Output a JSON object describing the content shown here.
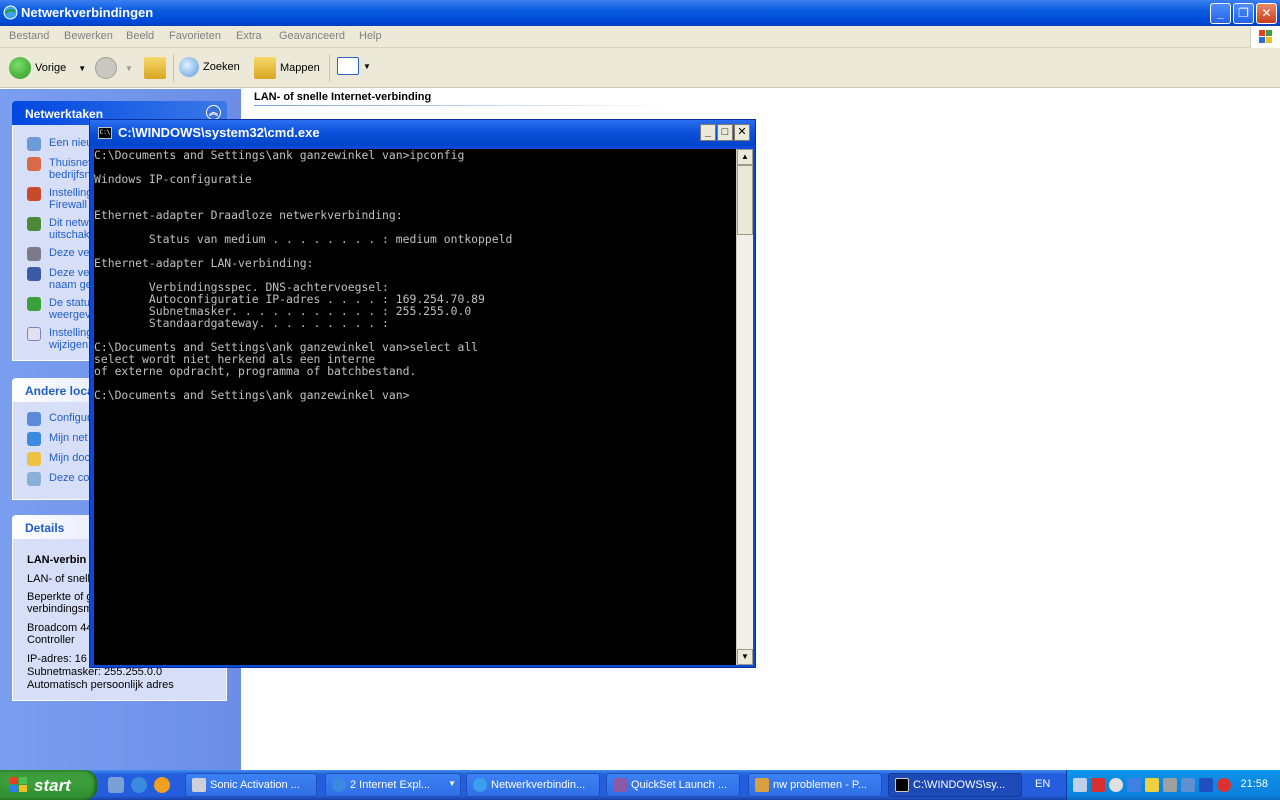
{
  "explorer": {
    "title": "Netwerkverbindingen",
    "menu": [
      "Bestand",
      "Bewerken",
      "Beeld",
      "Favorieten",
      "Extra",
      "Geavanceerd",
      "Help"
    ],
    "toolbar": {
      "back": "Vorige",
      "search": "Zoeken",
      "folders": "Mappen"
    },
    "main_heading": "LAN- of snelle Internet-verbinding"
  },
  "taskpane": {
    "network_tasks": {
      "title": "Netwerktaken",
      "items": [
        [
          "Een nieu"
        ],
        [
          "Thuisnet",
          "bedrijfsn"
        ],
        [
          "Instelling",
          "Firewall"
        ],
        [
          "Dit netw",
          "uitschak"
        ],
        [
          "Deze ve"
        ],
        [
          "Deze ve",
          "naam ge"
        ],
        [
          "De statu",
          "weergev"
        ],
        [
          "Instelling",
          "wijzigen"
        ]
      ]
    },
    "other_places": {
      "title": "Andere loca",
      "items": [
        "Configur",
        "Mijn net",
        "Mijn doc",
        "Deze co"
      ]
    },
    "details": {
      "title": "Details",
      "name": "LAN-verbin",
      "lines": [
        "LAN- of snell",
        "Beperkte of g",
        "verbindingsm",
        "Broadcom 44",
        "Controller",
        "IP-adres: 16",
        "Subnetmasker: 255.255.0.0",
        "Automatisch persoonlijk adres"
      ]
    }
  },
  "cmd": {
    "title": "C:\\WINDOWS\\system32\\cmd.exe",
    "icon_text": "C:\\",
    "lines": [
      "C:\\Documents and Settings\\ank ganzewinkel van>ipconfig",
      "",
      "Windows IP-configuratie",
      "",
      "",
      "Ethernet-adapter Draadloze netwerkverbinding:",
      "",
      "        Status van medium . . . . . . . . : medium ontkoppeld",
      "",
      "Ethernet-adapter LAN-verbinding:",
      "",
      "        Verbindingsspec. DNS-achtervoegsel:",
      "        Autoconfiguratie IP-adres . . . . : 169.254.70.89",
      "        Subnetmasker. . . . . . . . . . . : 255.255.0.0",
      "        Standaardgateway. . . . . . . . . :",
      "",
      "C:\\Documents and Settings\\ank ganzewinkel van>select all",
      "select wordt niet herkend als een interne",
      "of externe opdracht, programma of batchbestand.",
      "",
      "C:\\Documents and Settings\\ank ganzewinkel van>"
    ]
  },
  "taskbar": {
    "start": "start",
    "tasks": [
      "Sonic Activation ...",
      "2 Internet Expl...",
      "Netwerkverbindin...",
      "QuickSet Launch ...",
      "nw problemen - P...",
      "C:\\WINDOWS\\sy..."
    ],
    "language": "EN",
    "clock": "21:58"
  },
  "colors": {
    "xp_blue": "#0a5be0",
    "taskbar": "#245edc",
    "start_green": "#3c9a3c",
    "console_text": "#c0c0c0"
  }
}
